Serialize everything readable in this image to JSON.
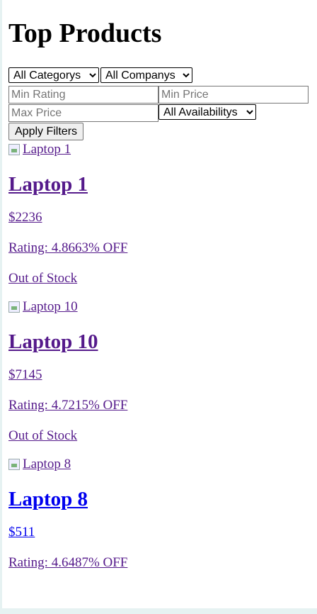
{
  "page": {
    "title": "Top Products"
  },
  "filters": {
    "category": "All Categorys",
    "company": "All Companys",
    "min_rating_placeholder": "Min Rating",
    "min_price_placeholder": "Min Price",
    "max_price_placeholder": "Max Price",
    "availability": "All Availabilitys",
    "apply_label": "Apply Filters"
  },
  "products": [
    {
      "image_alt": "Laptop 1",
      "name": "Laptop 1",
      "price": "$2236",
      "rating": "Rating: 4.8663% OFF",
      "stock": "Out of Stock"
    },
    {
      "image_alt": "Laptop 10",
      "name": "Laptop 10",
      "price": "$7145",
      "rating": "Rating: 4.7215% OFF",
      "stock": "Out of Stock"
    },
    {
      "image_alt": "Laptop 8",
      "name": "Laptop 8",
      "price": "$511",
      "rating": "Rating: 4.6487% OFF",
      "stock": ""
    }
  ]
}
